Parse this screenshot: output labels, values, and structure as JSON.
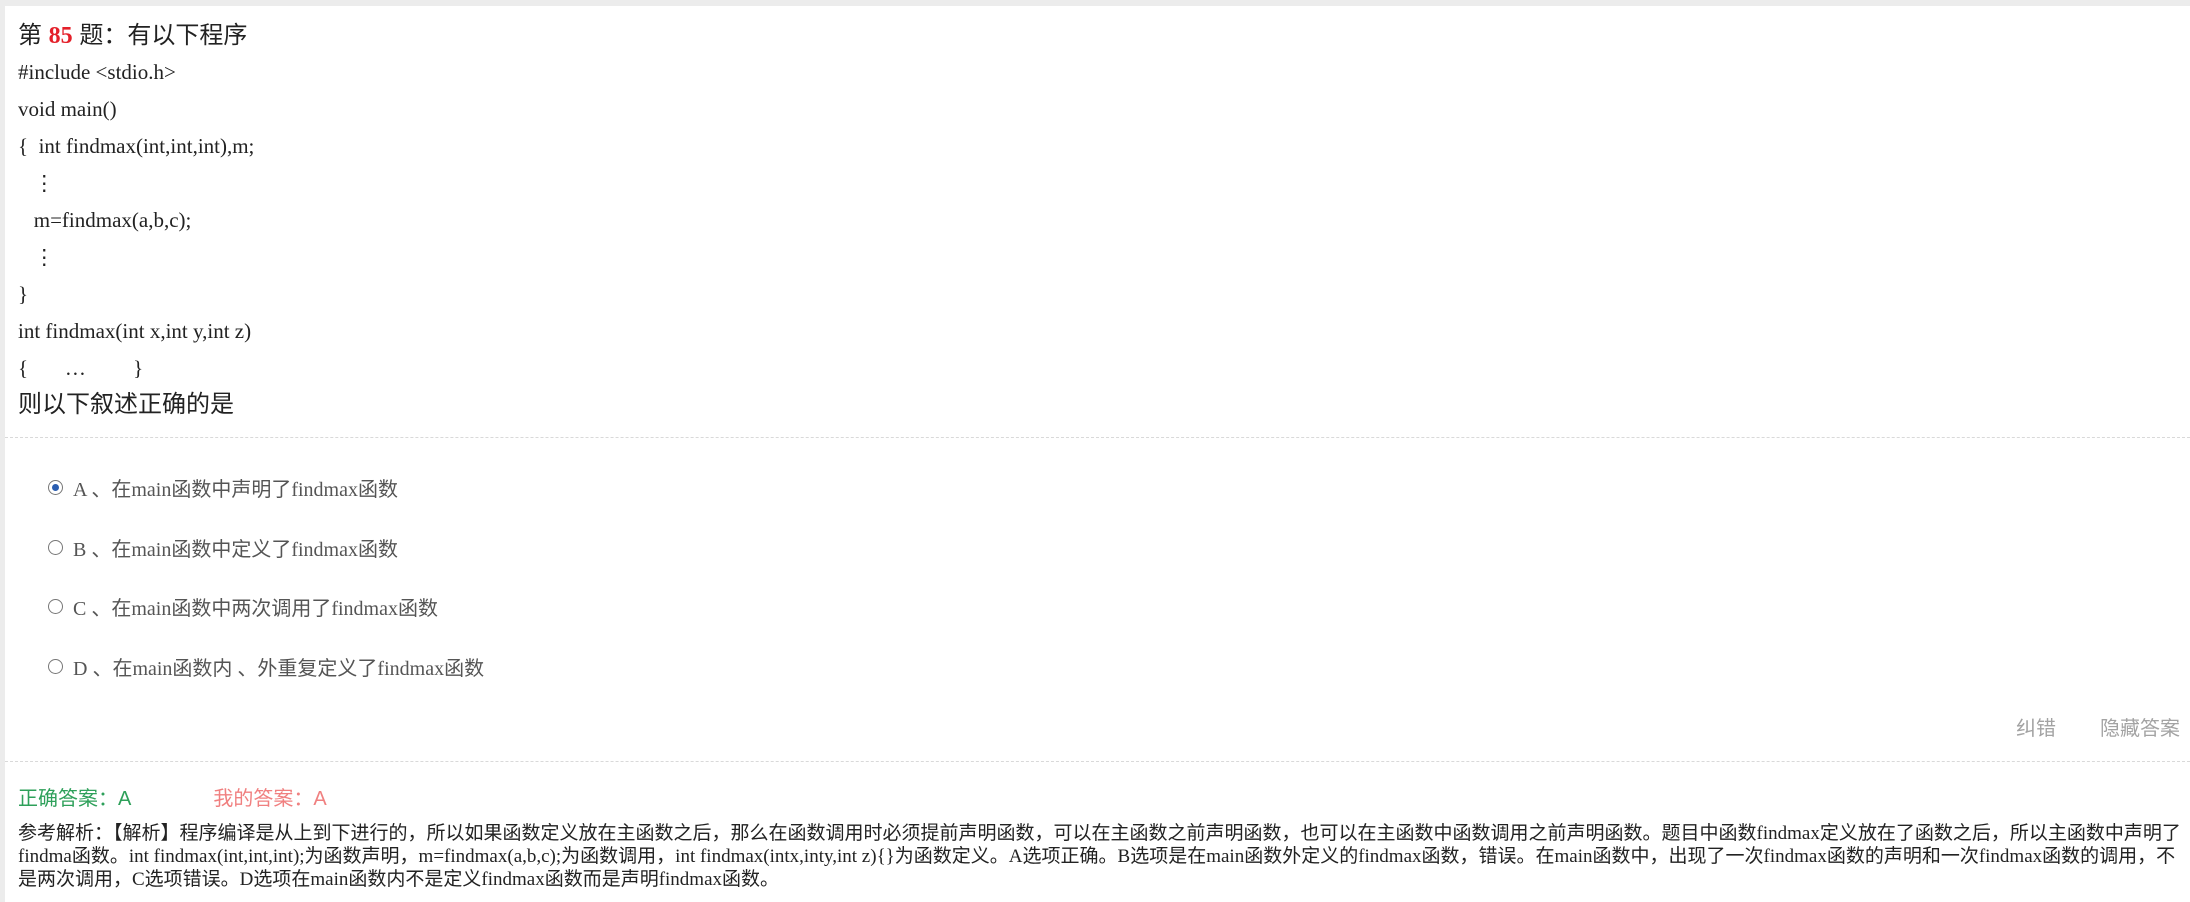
{
  "question": {
    "prefix": "第 ",
    "number": "85",
    "suffix": " 题：有以下程序",
    "code_lines": [
      "#include <stdio.h>",
      "void main()",
      "{  int findmax(int,int,int),m;",
      "   ⋮",
      "   m=findmax(a,b,c);",
      "   ⋮",
      "}",
      "int findmax(int x,int y,int z)",
      "{       …         }"
    ],
    "closing": "则以下叙述正确的是"
  },
  "options": [
    {
      "label": "A 、在main函数中声明了findmax函数",
      "selected": true
    },
    {
      "label": "B 、在main函数中定义了findmax函数",
      "selected": false
    },
    {
      "label": "C 、在main函数中两次调用了findmax函数",
      "selected": false
    },
    {
      "label": "D 、在main函数内 、外重复定义了findmax函数",
      "selected": false
    }
  ],
  "actions": {
    "report_error": "纠错",
    "hide_answer": "隐藏答案"
  },
  "answers": {
    "correct": "正确答案：A",
    "mine": "我的答案：A"
  },
  "analysis": "参考解析：【解析】程序编译是从上到下进行的，所以如果函数定义放在主函数之后，那么在函数调用时必须提前声明函数，可以在主函数之前声明函数，也可以在主函数中函数调用之前声明函数。题目中函数findmax定义放在了函数之后，所以主函数中声明了findma函数。int findmax(int,int,int);为函数声明，m=findmax(a,b,c);为函数调用，int findmax(intx,inty,int z){}为函数定义。A选项正确。B选项是在main函数外定义的findmax函数，错误。在main函数中，出现了一次findmax函数的声明和一次findmax函数的调用，不是两次调用，C选项错误。D选项在main函数内不是定义findmax函数而是声明findmax函数。",
  "colors": {
    "question_number": "#e4202a",
    "correct_answer": "#2ea05a",
    "my_answer": "#f08080",
    "radio_selected": "#2a5db0",
    "action_text": "#a3a3a3"
  }
}
